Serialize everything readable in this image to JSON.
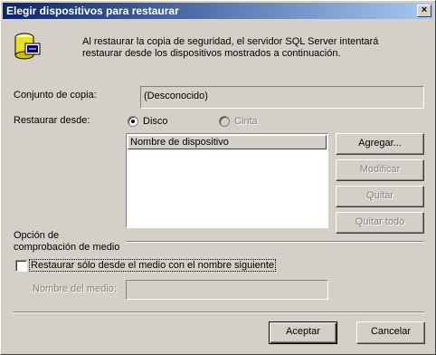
{
  "window": {
    "title": "Elegir dispositivos para restaurar",
    "close_label": "×"
  },
  "intro": {
    "icon": "database-icon",
    "text": "Al restaurar la copia de seguridad, el servidor SQL Server intentará restaurar desde los dispositivos mostrados a continuación."
  },
  "backup_set": {
    "label": "Conjunto de copia:",
    "value": "(Desconocido)"
  },
  "restore_from": {
    "label": "Restaurar desde:",
    "options": [
      {
        "label": "Disco",
        "checked": true,
        "enabled": true
      },
      {
        "label": "Cinta",
        "checked": false,
        "enabled": false
      }
    ]
  },
  "device_list": {
    "column_header": "Nombre de dispositivo",
    "items": []
  },
  "buttons": {
    "add": "Agregar...",
    "modify": "Modificar",
    "remove": "Quitar",
    "remove_all": "Quitar todo",
    "ok": "Aceptar",
    "cancel": "Cancelar"
  },
  "media_check": {
    "group_label": "Opción de comprobación de medio",
    "checkbox_label": "Restaurar sólo desde el medio con el nombre siguiente",
    "checkbox_checked": false,
    "media_name_label": "Nombre del medio:",
    "media_name_value": ""
  }
}
